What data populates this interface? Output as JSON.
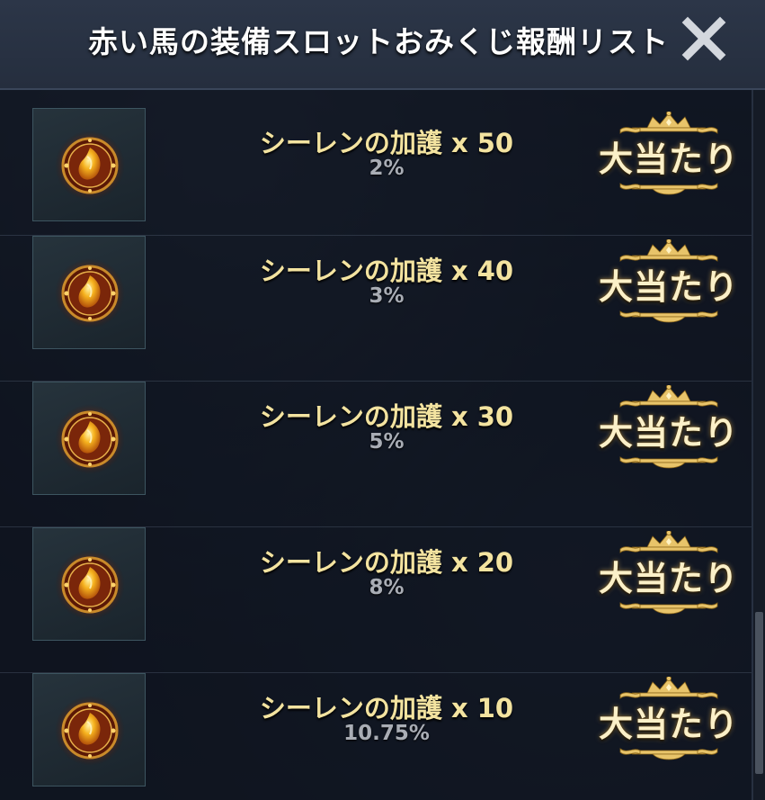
{
  "window": {
    "title": "赤い馬の装備スロットおみくじ報酬リスト",
    "close_icon": "close-x-icon"
  },
  "rewards": [
    {
      "name": "シーレンの加護 x 50",
      "rate": "2%",
      "badge": "大当たり",
      "icon": "siren-blessing-orb-icon"
    },
    {
      "name": "シーレンの加護 x 40",
      "rate": "3%",
      "badge": "大当たり",
      "icon": "siren-blessing-orb-icon"
    },
    {
      "name": "シーレンの加護 x 30",
      "rate": "5%",
      "badge": "大当たり",
      "icon": "siren-blessing-orb-icon"
    },
    {
      "name": "シーレンの加護 x 20",
      "rate": "8%",
      "badge": "大当たり",
      "icon": "siren-blessing-orb-icon"
    },
    {
      "name": "シーレンの加護 x 10",
      "rate": "10.75%",
      "badge": "大当たり",
      "icon": "siren-blessing-orb-icon"
    }
  ],
  "colors": {
    "reward_name": "#f3e3a0",
    "reward_rate": "#a9adb5",
    "badge_gold": "#e8c46a",
    "panel_bg": "#0b101b"
  }
}
